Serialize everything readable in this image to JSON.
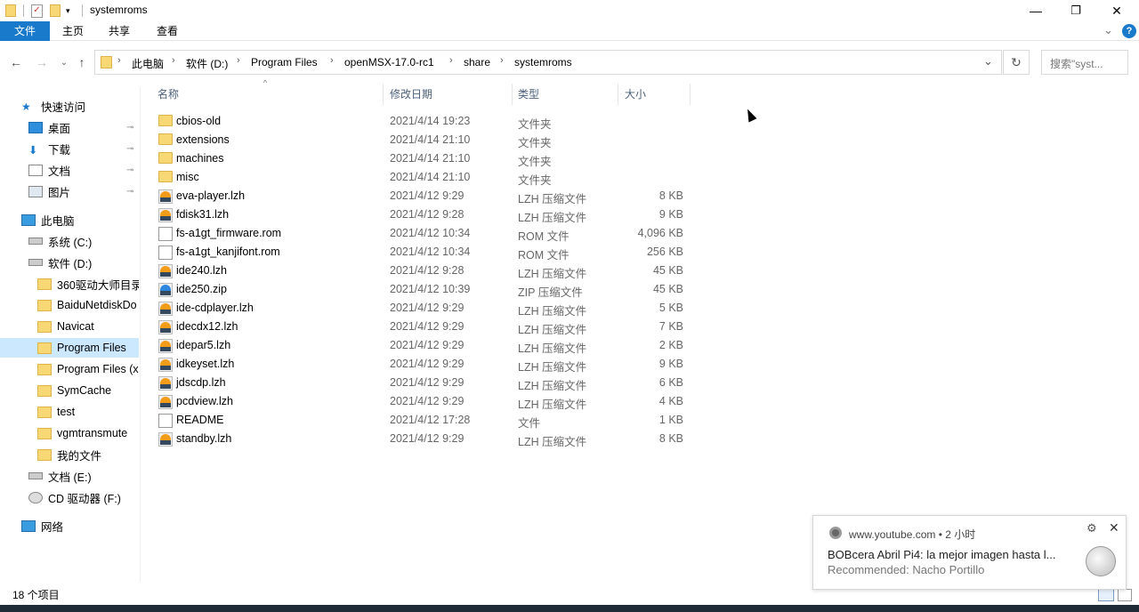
{
  "window": {
    "title": "systemroms",
    "minimize_glyph": "—",
    "maximize_glyph": "❐",
    "close_glyph": "✕"
  },
  "ribbon": {
    "tabs": [
      "文件",
      "主页",
      "共享",
      "查看"
    ],
    "expand_glyph": "⌄",
    "help_glyph": "?"
  },
  "nav": {
    "back_glyph": "←",
    "forward_glyph": "→",
    "recent_glyph": "⌄",
    "up_glyph": "↑",
    "breadcrumb": [
      "此电脑",
      "软件 (D:)",
      "Program Files",
      "openMSX-17.0-rc1",
      "share",
      "systemroms"
    ],
    "separator": "›",
    "dropdown_glyph": "⌄",
    "refresh_glyph": "↻",
    "search_placeholder": "搜索\"syst..."
  },
  "sidebar": {
    "items": [
      {
        "label": "快速访问",
        "icon": "star-icon"
      },
      {
        "label": "桌面",
        "icon": "desktop-icon",
        "pinned": true
      },
      {
        "label": "下载",
        "icon": "download-icon",
        "pinned": true
      },
      {
        "label": "文档",
        "icon": "document-icon",
        "pinned": true
      },
      {
        "label": "图片",
        "icon": "picture-icon",
        "pinned": true
      },
      {
        "label": "此电脑",
        "icon": "computer-icon"
      },
      {
        "label": "系统 (C:)",
        "icon": "drive-icon"
      },
      {
        "label": "软件 (D:)",
        "icon": "drive-icon"
      },
      {
        "label": "360驱动大师目录",
        "icon": "folder-icon"
      },
      {
        "label": "BaiduNetdiskDo",
        "icon": "folder-icon"
      },
      {
        "label": "Navicat",
        "icon": "folder-icon"
      },
      {
        "label": "Program Files",
        "icon": "folder-icon",
        "selected": true
      },
      {
        "label": "Program Files (x",
        "icon": "folder-icon"
      },
      {
        "label": "SymCache",
        "icon": "folder-icon"
      },
      {
        "label": "test",
        "icon": "folder-icon"
      },
      {
        "label": "vgmtransmute",
        "icon": "folder-icon"
      },
      {
        "label": "我的文件",
        "icon": "folder-icon"
      },
      {
        "label": "文档 (E:)",
        "icon": "drive-icon"
      },
      {
        "label": "CD 驱动器 (F:)",
        "icon": "cd-drive-icon"
      },
      {
        "label": "网络",
        "icon": "network-icon"
      }
    ],
    "pin_glyph": "📌"
  },
  "columns": {
    "name": "名称",
    "date": "修改日期",
    "type": "类型",
    "size": "大小",
    "sort_glyph": "^"
  },
  "files": [
    {
      "name": "cbios-old",
      "date": "2021/4/14 19:23",
      "type": "文件夹",
      "size": "",
      "kind": "folder"
    },
    {
      "name": "extensions",
      "date": "2021/4/14 21:10",
      "type": "文件夹",
      "size": "",
      "kind": "folder"
    },
    {
      "name": "machines",
      "date": "2021/4/14 21:10",
      "type": "文件夹",
      "size": "",
      "kind": "folder"
    },
    {
      "name": "misc",
      "date": "2021/4/14 21:10",
      "type": "文件夹",
      "size": "",
      "kind": "folder"
    },
    {
      "name": "eva-player.lzh",
      "date": "2021/4/12 9:29",
      "type": "LZH 压缩文件",
      "size": "8 KB",
      "kind": "archive"
    },
    {
      "name": "fdisk31.lzh",
      "date": "2021/4/12 9:28",
      "type": "LZH 压缩文件",
      "size": "9 KB",
      "kind": "archive"
    },
    {
      "name": "fs-a1gt_firmware.rom",
      "date": "2021/4/12 10:34",
      "type": "ROM 文件",
      "size": "4,096 KB",
      "kind": "doc"
    },
    {
      "name": "fs-a1gt_kanjifont.rom",
      "date": "2021/4/12 10:34",
      "type": "ROM 文件",
      "size": "256 KB",
      "kind": "doc"
    },
    {
      "name": "ide240.lzh",
      "date": "2021/4/12 9:28",
      "type": "LZH 压缩文件",
      "size": "45 KB",
      "kind": "archive"
    },
    {
      "name": "ide250.zip",
      "date": "2021/4/12 10:39",
      "type": "ZIP 压缩文件",
      "size": "45 KB",
      "kind": "zip"
    },
    {
      "name": "ide-cdplayer.lzh",
      "date": "2021/4/12 9:29",
      "type": "LZH 压缩文件",
      "size": "5 KB",
      "kind": "archive"
    },
    {
      "name": "idecdx12.lzh",
      "date": "2021/4/12 9:29",
      "type": "LZH 压缩文件",
      "size": "7 KB",
      "kind": "archive"
    },
    {
      "name": "idepar5.lzh",
      "date": "2021/4/12 9:29",
      "type": "LZH 压缩文件",
      "size": "2 KB",
      "kind": "archive"
    },
    {
      "name": "idkeyset.lzh",
      "date": "2021/4/12 9:29",
      "type": "LZH 压缩文件",
      "size": "9 KB",
      "kind": "archive"
    },
    {
      "name": "jdscdp.lzh",
      "date": "2021/4/12 9:29",
      "type": "LZH 压缩文件",
      "size": "6 KB",
      "kind": "archive"
    },
    {
      "name": "pcdview.lzh",
      "date": "2021/4/12 9:29",
      "type": "LZH 压缩文件",
      "size": "4 KB",
      "kind": "archive"
    },
    {
      "name": "README",
      "date": "2021/4/12 17:28",
      "type": "文件",
      "size": "1 KB",
      "kind": "doc"
    },
    {
      "name": "standby.lzh",
      "date": "2021/4/12 9:29",
      "type": "LZH 压缩文件",
      "size": "8 KB",
      "kind": "archive"
    }
  ],
  "status": {
    "item_count": "18 个项目"
  },
  "notification": {
    "site": "www.youtube.com • 2 小时",
    "title": "BOBcera Abril Pi4: la mejor imagen hasta l...",
    "subtitle": "Recommended: Nacho Portillo",
    "gear_glyph": "⚙",
    "close_glyph": "✕"
  }
}
